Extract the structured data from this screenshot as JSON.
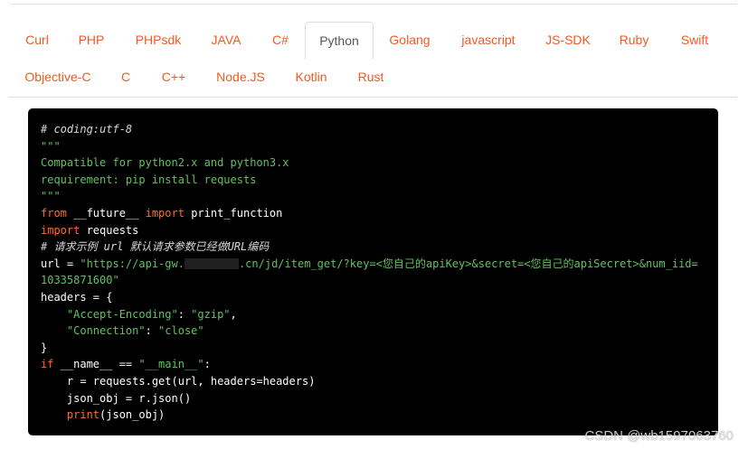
{
  "tabs": [
    {
      "label": "Curl",
      "active": false
    },
    {
      "label": "PHP",
      "active": false
    },
    {
      "label": "PHPsdk",
      "active": false
    },
    {
      "label": "JAVA",
      "active": false
    },
    {
      "label": "C#",
      "active": false
    },
    {
      "label": "Python",
      "active": true
    },
    {
      "label": "Golang",
      "active": false
    },
    {
      "label": "javascript",
      "active": false
    },
    {
      "label": "JS-SDK",
      "active": false
    },
    {
      "label": "Ruby",
      "active": false
    },
    {
      "label": "Swift",
      "active": false
    },
    {
      "label": "Objective-C",
      "active": false
    },
    {
      "label": "C",
      "active": false
    },
    {
      "label": "C++",
      "active": false
    },
    {
      "label": "Node.JS",
      "active": false
    },
    {
      "label": "Kotlin",
      "active": false
    },
    {
      "label": "Rust",
      "active": false
    }
  ],
  "code": {
    "l1": "# coding:utf-8",
    "l2": "\"\"\"",
    "l3": "Compatible for python2.x and python3.x",
    "l4": "requirement: pip install requests",
    "l5": "\"\"\"",
    "l6_kw1": "from",
    "l6_a": " __future__ ",
    "l6_kw2": "import",
    "l6_b": " print_function",
    "l7_kw": "import",
    "l7_a": " requests",
    "l8": "# 请求示例 url 默认请求参数已经做URL编码",
    "l9_a": "url = ",
    "l9_s1": "\"https://api-gw.",
    "l9_s2": ".cn/jd/item_get/?key=<您自己的apiKey>&secret=<您自己的apiSecret>&num_iid=",
    "l10": "10335871600\"",
    "l11": "headers = {",
    "l12_s1": "    \"Accept-Encoding\"",
    "l12_a": ": ",
    "l12_s2": "\"gzip\"",
    "l12_b": ",",
    "l13_s1": "    \"Connection\"",
    "l13_a": ": ",
    "l13_s2": "\"close\"",
    "l14": "}",
    "l15_kw": "if",
    "l15_a": " __name__ == ",
    "l15_s": "\"__main__\"",
    "l15_b": ":",
    "l16": "    r = requests.get(url, headers=headers)",
    "l17": "    json_obj = r.json()",
    "l18_pad": "    ",
    "l18_kw": "print",
    "l18_a": "(json_obj)"
  },
  "watermark": "CSDN @wb1597063760",
  "colors": {
    "accent": "#f15a22",
    "string": "#5ec25e",
    "keyword": "#ff6a2b",
    "code_bg": "#000000"
  }
}
